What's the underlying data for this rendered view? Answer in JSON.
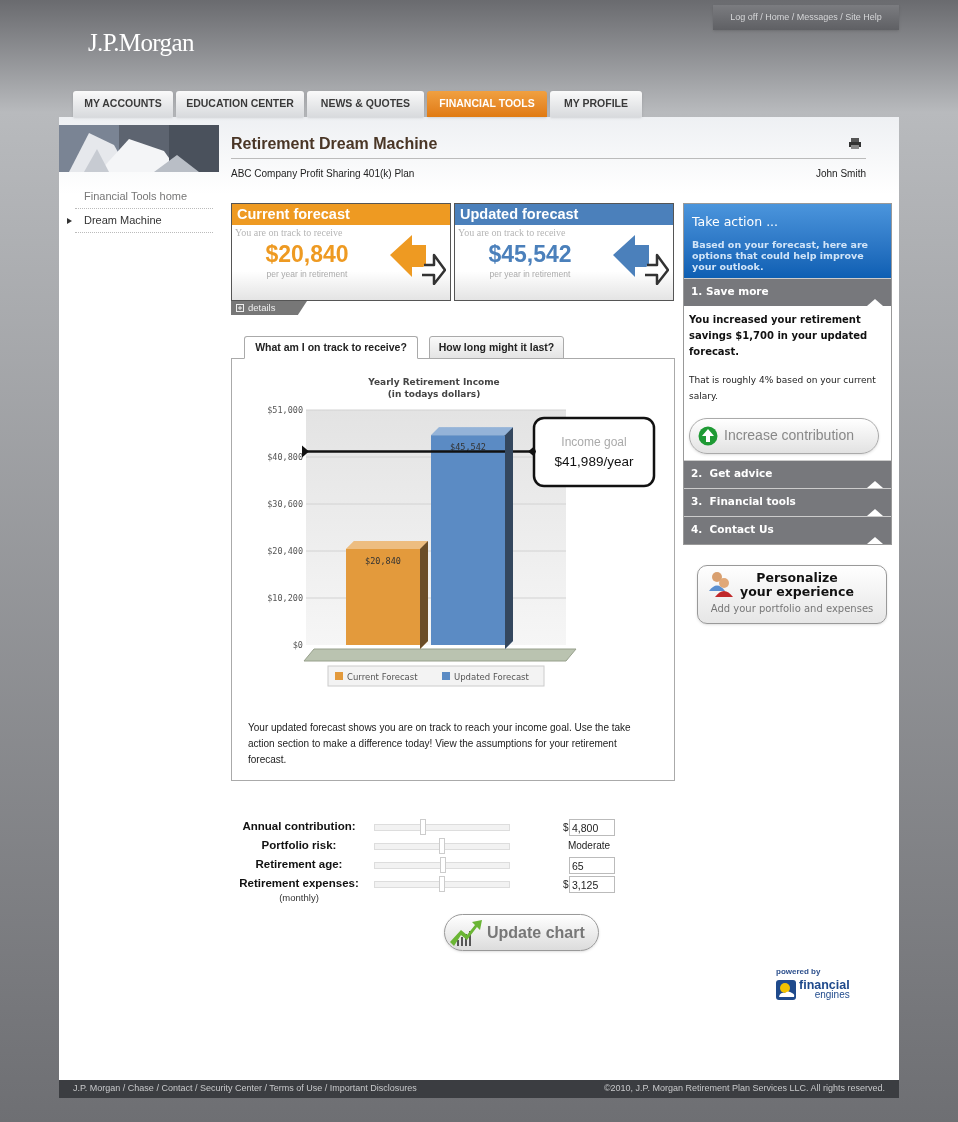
{
  "header": {
    "logo": "J.P.Morgan",
    "utility_links": "Log off / Home / Messages / Site Help"
  },
  "nav_tabs": [
    {
      "label": "MY ACCOUNTS",
      "selected": false
    },
    {
      "label": "EDUCATION CENTER",
      "selected": false
    },
    {
      "label": "NEWS & QUOTES",
      "selected": false
    },
    {
      "label": "FINANCIAL TOOLS",
      "selected": true
    },
    {
      "label": "MY PROFILE",
      "selected": false
    }
  ],
  "sidebar": {
    "items": [
      {
        "label": "Financial Tools home",
        "selected": false
      },
      {
        "label": "Dream Machine",
        "selected": true
      }
    ]
  },
  "page": {
    "title": "Retirement Dream Machine",
    "plan": "ABC Company Profit Sharing 401(k) Plan",
    "user": "John Smith"
  },
  "forecasts": [
    {
      "title": "Current forecast",
      "color": "#ee9a22",
      "intro": "You are on track to receive",
      "amount": "$20,840",
      "caption": "per year in retirement"
    },
    {
      "title": "Updated forecast",
      "color": "#4b80bb",
      "intro": "You are on track to receive",
      "amount": "$45,542",
      "caption": "per year in retirement"
    }
  ],
  "details_toggle": "details",
  "chart_tabs": [
    {
      "label": "What am I on track to receive?",
      "selected": true
    },
    {
      "label": "How long might it last?",
      "selected": false
    }
  ],
  "chart_subtitle": "(in todays dollars)",
  "chart_data": {
    "type": "bar",
    "title": "Yearly Retirement Income",
    "series": [
      {
        "name": "Current Forecast",
        "color": "#e39a3c",
        "values": [
          20840
        ],
        "value_labels": [
          "$20,840"
        ]
      },
      {
        "name": "Updated Forecast",
        "color": "#5b8bc4",
        "values": [
          45542
        ],
        "value_labels": [
          "$45,542"
        ]
      }
    ],
    "ylim": [
      0,
      51000
    ],
    "yticks": [
      {
        "value": 0,
        "label": "$0"
      },
      {
        "value": 10200,
        "label": "$10,200"
      },
      {
        "value": 20400,
        "label": "$20,400"
      },
      {
        "value": 30600,
        "label": "$30,600"
      },
      {
        "value": 40800,
        "label": "$40,800"
      },
      {
        "value": 51000,
        "label": "$51,000"
      }
    ],
    "data_labels": true,
    "grid": true,
    "legend": true,
    "annotations": [
      "Income goal",
      "$41,989/year"
    ]
  },
  "summary": "Your updated forecast shows you are on track to reach your income goal. Use the take action section to make a difference today! View the assumptions for your retirement forecast.",
  "inputs": [
    {
      "label": "Annual contribution:",
      "level": 0.36,
      "kind": "currency",
      "prefix": "$",
      "value": "4,800"
    },
    {
      "label": "Portfolio risk:",
      "level": 0.5,
      "kind": "text",
      "value": "Moderate"
    },
    {
      "label": "Retirement age:",
      "level": 0.51,
      "kind": "number",
      "value": "65"
    },
    {
      "label": "Retirement expenses:",
      "note": "(monthly)",
      "level": 0.5,
      "kind": "currency",
      "prefix": "$",
      "value": "3,125"
    }
  ],
  "update_button": "Update chart",
  "take_action": {
    "title": "Take action ...",
    "intro": "Based on your forecast, here are options that could help improve your outlook.",
    "sections": [
      {
        "title": "1. Save more",
        "headline": "You increased your retirement savings $1,700 in your updated forecast.",
        "text": "That is roughly 4% based on your current salary.",
        "button": "Increase contribution"
      },
      {
        "title": "2.  Get advice"
      },
      {
        "title": "3.  Financial tools"
      },
      {
        "title": "4.  Contact Us"
      }
    ]
  },
  "personalize": {
    "title": "Personalize your experience",
    "subtitle": "Add your portfolio and expenses"
  },
  "powered_by": {
    "caption": "powered by",
    "brand": "financial",
    "brand_sub": "engines"
  },
  "footer": {
    "links": "J.P. Morgan / Chase / Contact / Security Center / Terms of Use / Important Disclosures",
    "copyright": "©2010, J.P. Morgan Retirement Plan Services LLC. All rights reserved."
  }
}
